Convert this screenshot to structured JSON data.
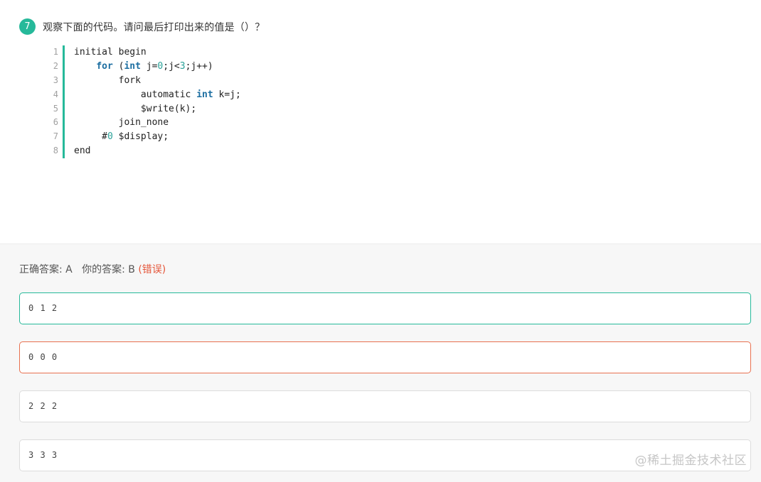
{
  "question": {
    "number": "7",
    "text": "观察下面的代码。请问最后打印出来的值是（）？"
  },
  "code": {
    "line_numbers": [
      "1",
      "2",
      "3",
      "4",
      "5",
      "6",
      "7",
      "8"
    ],
    "lines": [
      "initial begin",
      "    for (int j=0;j<3;j++)",
      "        fork",
      "            automatic int k=j;",
      "            $write(k);",
      "        join_none",
      "     #0 $display;",
      "end"
    ]
  },
  "result": {
    "correct_label": "正确答案: A",
    "your_label": "你的答案: B",
    "status": "(错误)"
  },
  "options": [
    {
      "text": "0 1 2",
      "state": "correct"
    },
    {
      "text": "0 0 0",
      "state": "incorrect"
    },
    {
      "text": "2 2 2",
      "state": "neutral"
    },
    {
      "text": "3 3 3",
      "state": "neutral"
    }
  ],
  "watermark": "@稀土掘金技术社区",
  "colors": {
    "accent": "#26b99a",
    "error": "#e5573b"
  }
}
